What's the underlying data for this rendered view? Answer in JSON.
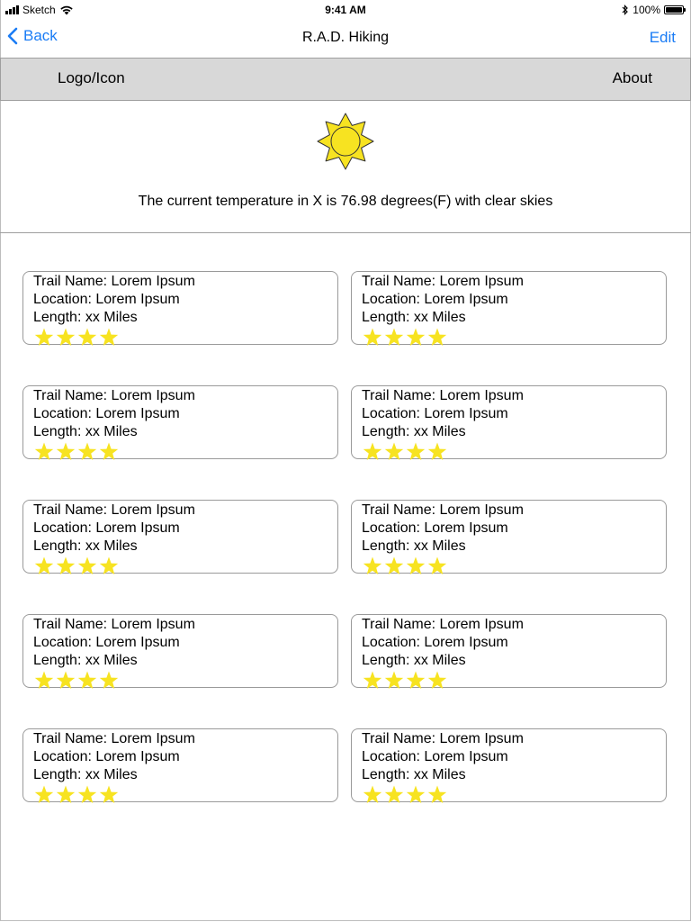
{
  "status_bar": {
    "carrier": "Sketch",
    "time": "9:41 AM",
    "battery": "100%",
    "battery_level": 1.0
  },
  "nav": {
    "back_label": "Back",
    "title": "R.A.D. Hiking",
    "edit_label": "Edit"
  },
  "header": {
    "logo": "Logo/Icon",
    "about": "About"
  },
  "weather": {
    "icon": "sun-icon",
    "text": "The current temperature in X is 76.98 degrees(F) with clear skies"
  },
  "colors": {
    "accent": "#1a7cf5",
    "header_bg": "#d8d8d8",
    "star": "#f7e321",
    "sun": "#f7e321"
  },
  "trails": [
    {
      "name": "Trail Name: Lorem Ipsum",
      "location": "Location: Lorem Ipsum",
      "length": "Length: xx Miles",
      "rating": 4
    },
    {
      "name": "Trail Name: Lorem Ipsum",
      "location": "Location: Lorem Ipsum",
      "length": "Length: xx Miles",
      "rating": 4
    },
    {
      "name": "Trail Name: Lorem Ipsum",
      "location": "Location: Lorem Ipsum",
      "length": "Length: xx Miles",
      "rating": 4
    },
    {
      "name": "Trail Name: Lorem Ipsum",
      "location": "Location: Lorem Ipsum",
      "length": "Length: xx Miles",
      "rating": 4
    },
    {
      "name": "Trail Name: Lorem Ipsum",
      "location": "Location: Lorem Ipsum",
      "length": "Length: xx Miles",
      "rating": 4
    },
    {
      "name": "Trail Name: Lorem Ipsum",
      "location": "Location: Lorem Ipsum",
      "length": "Length: xx Miles",
      "rating": 4
    },
    {
      "name": "Trail Name: Lorem Ipsum",
      "location": "Location: Lorem Ipsum",
      "length": "Length: xx Miles",
      "rating": 4
    },
    {
      "name": "Trail Name: Lorem Ipsum",
      "location": "Location: Lorem Ipsum",
      "length": "Length: xx Miles",
      "rating": 4
    },
    {
      "name": "Trail Name: Lorem Ipsum",
      "location": "Location: Lorem Ipsum",
      "length": "Length: xx Miles",
      "rating": 4
    },
    {
      "name": "Trail Name: Lorem Ipsum",
      "location": "Location: Lorem Ipsum",
      "length": "Length: xx Miles",
      "rating": 4
    }
  ]
}
